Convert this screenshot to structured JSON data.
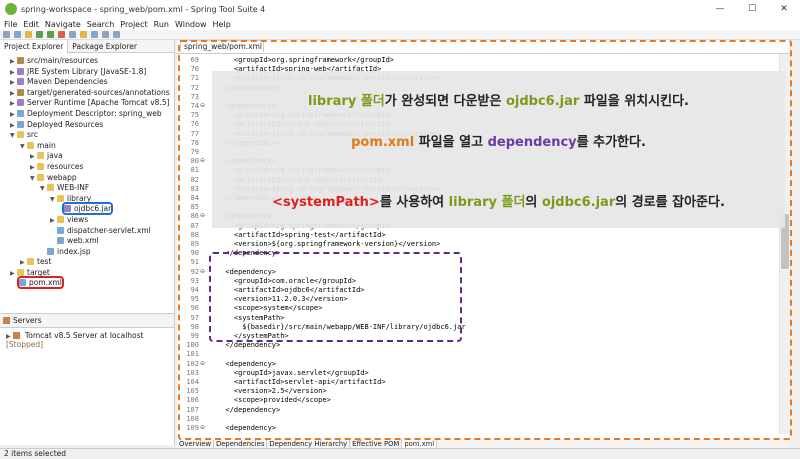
{
  "window": {
    "title": "spring-workspace - spring_web/pom.xml - Spring Tool Suite 4",
    "min": "—",
    "max": "☐",
    "close": "✕"
  },
  "menu": [
    "File",
    "Edit",
    "Navigate",
    "Search",
    "Project",
    "Run",
    "Window",
    "Help"
  ],
  "left_tabs": {
    "project_explorer": "Project Explorer",
    "package_explorer": "Package Explorer"
  },
  "tree": [
    "src/main/resources",
    "JRE System Library [JavaSE-1.8]",
    "Maven Dependencies",
    "target/generated-sources/annotations",
    "Server Runtime [Apache Tomcat v8.5]",
    "Deployment Descriptor: spring_web",
    "Deployed Resources",
    "src",
    "main",
    "java",
    "resources",
    "webapp",
    "WEB-INF",
    "library",
    "ojdbc6.jar",
    "views",
    "dispatcher-servlet.xml",
    "web.xml",
    "index.jsp",
    "test",
    "target",
    "pom.xml"
  ],
  "servers": {
    "tab": "Servers",
    "entry": "Tomcat v8.5 Server at localhost",
    "state": "[Stopped]"
  },
  "status": "2 items selected",
  "editor_tab": "spring_web/pom.xml",
  "line_numbers": [
    "69",
    "70",
    "71",
    "72",
    "73",
    "74",
    "75",
    "76",
    "77",
    "78",
    "79",
    "80",
    "81",
    "82",
    "83",
    "84",
    "85",
    "86",
    "87",
    "88",
    "89",
    "90",
    "91",
    "92",
    "93",
    "94",
    "95",
    "96",
    "97",
    "98",
    "99",
    "100",
    "101",
    "102",
    "103",
    "104",
    "105",
    "106",
    "107",
    "108",
    "109"
  ],
  "code_lines": [
    "    <groupId>org.springframework</groupId>",
    "    <artifactId>spring-web</artifactId>",
    "    <version>${org.springframework-version}</version>",
    "  </dependency>",
    "",
    "  <dependency>",
    "    <groupId>org.springframework</groupId>",
    "    <artifactId>spring-webmvc</artifactId>",
    "    <version>${org.springframework-version}</version>",
    "  </dependency>",
    "",
    "  <dependency>",
    "    <groupId>org.springframework</groupId>",
    "    <artifactId>spring-jdbc</artifactId>",
    "    <version>${org.springframework-version}</version>",
    "  </dependency>",
    "",
    "  <dependency>",
    "    <groupId>org.springframework</groupId>",
    "    <artifactId>spring-test</artifactId>",
    "    <version>${org.springframework-version}</version>",
    "  </dependency>",
    "",
    "  <dependency>",
    "    <groupId>com.oracle</groupId>",
    "    <artifactId>ojdbc6</artifactId>",
    "    <version>11.2.0.3</version>",
    "    <scope>system</scope>",
    "    <systemPath>",
    "      ${basedir}/src/main/webapp/WEB-INF/library/ojdbc6.jar",
    "    </systemPath>",
    "  </dependency>",
    "",
    "  <dependency>",
    "    <groupId>javax.servlet</groupId>",
    "    <artifactId>servlet-api</artifactId>",
    "    <version>2.5</version>",
    "    <scope>provided</scope>",
    "  </dependency>",
    "",
    "  <dependency>"
  ],
  "callout": {
    "l1_a": "library 폴더",
    "l1_b": "가 완성되면 다운받은 ",
    "l1_c": "ojdbc6.jar",
    "l1_d": " 파일을 위치시킨다.",
    "l2_a": "pom.xml",
    "l2_b": " 파일을 열고 ",
    "l2_c": "dependency",
    "l2_d": "를 추가한다.",
    "l3_a": "<systemPath>",
    "l3_b": "를 사용하여 ",
    "l3_c": "library 폴더",
    "l3_d": "의 ",
    "l3_e": "ojdbc6.jar",
    "l3_f": "의 경로를 잡아준다."
  },
  "bottom_tabs": [
    "Overview",
    "Dependencies",
    "Dependency Hierarchy",
    "Effective POM",
    "pom.xml"
  ],
  "colors": {
    "highlight_blue": "#1e6fd6",
    "highlight_red": "#e02020",
    "dash_orange": "#e47b23",
    "dash_purple": "#5b2a8c"
  }
}
